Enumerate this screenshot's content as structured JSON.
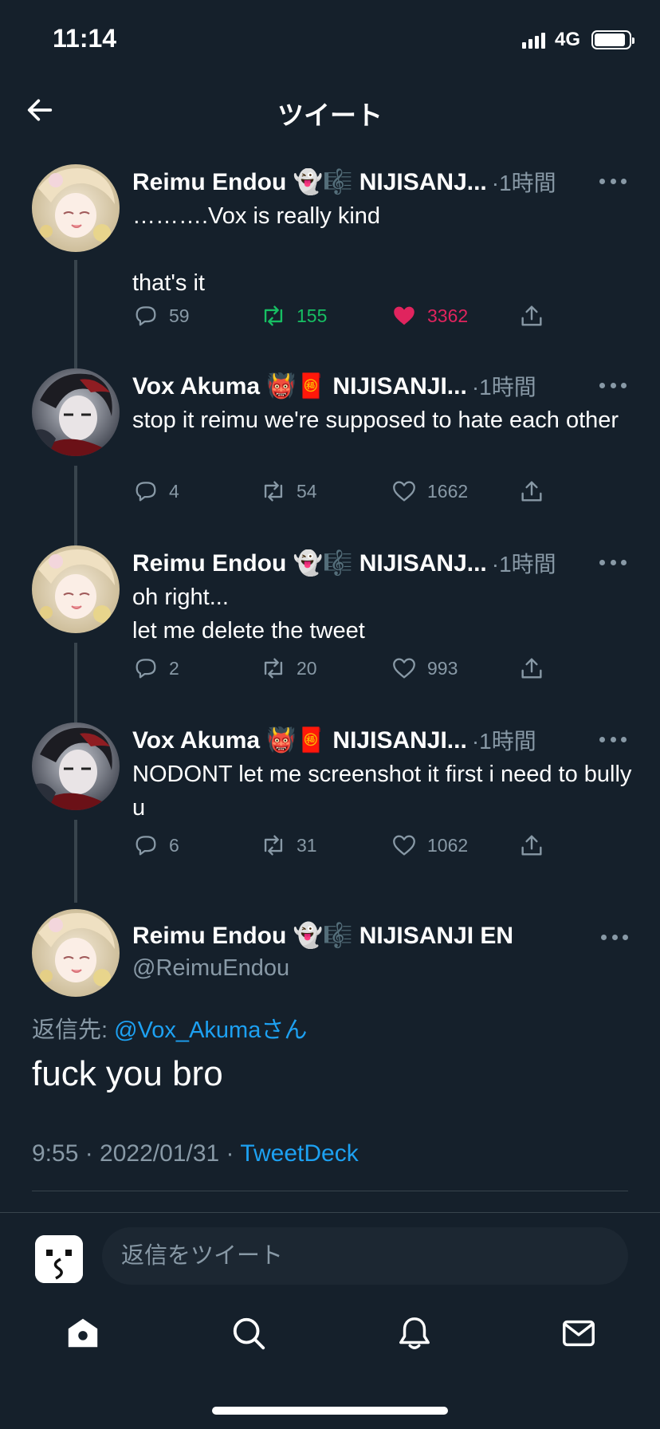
{
  "status_bar": {
    "time": "11:14",
    "network": "4G",
    "battery_level": 0.9
  },
  "header": {
    "title": "ツイート"
  },
  "thread": [
    {
      "name": "Reimu Endou 👻🎼 NIJISANJ...",
      "time": "·1時間",
      "text": "……….Vox is really kind\n\nthat's it",
      "avatar": "reimu",
      "replies": "59",
      "retweets": "155",
      "likes": "3362",
      "retweeted": true,
      "liked": true
    },
    {
      "name": "Vox Akuma 👹🧧 NIJISANJI...",
      "time": "·1時間",
      "text": "stop it reimu we're supposed to hate each other",
      "avatar": "vox",
      "replies": "4",
      "retweets": "54",
      "likes": "1662",
      "retweeted": false,
      "liked": false
    },
    {
      "name": "Reimu Endou 👻🎼 NIJISANJ...",
      "time": "·1時間",
      "text": "oh right...\nlet me delete the tweet",
      "avatar": "reimu",
      "replies": "2",
      "retweets": "20",
      "likes": "993",
      "retweeted": false,
      "liked": false
    },
    {
      "name": "Vox Akuma 👹🧧 NIJISANJI...",
      "time": "·1時間",
      "text": "NODONT let me screenshot it first i need to bully u",
      "avatar": "vox",
      "replies": "6",
      "retweets": "31",
      "likes": "1062",
      "retweeted": false,
      "liked": false
    }
  ],
  "main_tweet": {
    "name": "Reimu Endou 👻🎼 NIJISANJI EN",
    "handle": "@ReimuEndou",
    "replying_prefix": "返信先: ",
    "replying_to": "@Vox_Akumaさん",
    "text": "fuck you bro",
    "datetime": "9:55 · 2022/01/31 · ",
    "source": "TweetDeck"
  },
  "reply_bar": {
    "placeholder": "返信をツイート"
  },
  "tab_bar": {
    "items": [
      "home-icon",
      "search-icon",
      "bell-icon",
      "mail-icon"
    ]
  },
  "colors": {
    "background": "#15202b",
    "secondary_text": "#8899a6",
    "link": "#1da1f2",
    "retweet": "#17bf63",
    "like": "#e0245e"
  }
}
